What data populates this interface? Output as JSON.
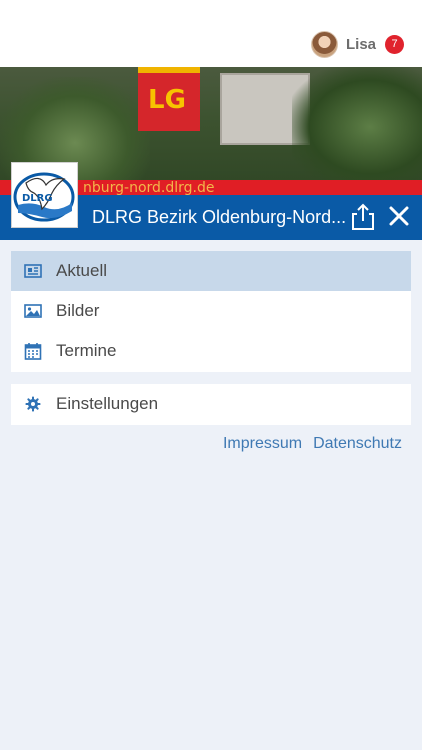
{
  "user": {
    "name": "Lisa",
    "notification_count": "7"
  },
  "banner": {
    "flag_text": "LG",
    "stripe_text": "nburg-nord.dlrg.de"
  },
  "logo": {
    "text": "DLRG"
  },
  "header": {
    "title": "DLRG Bezirk Oldenburg-Nord..."
  },
  "menu": {
    "main_items": [
      {
        "label": "Aktuell",
        "icon": "newspaper-icon",
        "active": true
      },
      {
        "label": "Bilder",
        "icon": "image-icon",
        "active": false
      },
      {
        "label": "Termine",
        "icon": "calendar-icon",
        "active": false
      }
    ],
    "settings": {
      "label": "Einstellungen",
      "icon": "gear-icon"
    }
  },
  "footer_links": {
    "impressum": "Impressum",
    "datenschutz": "Datenschutz"
  },
  "colors": {
    "header_blue": "#0a5aa6",
    "badge_red": "#e0232d",
    "active_row": "#c7d8ea",
    "link": "#3f79b3",
    "background": "#edf1f8"
  }
}
